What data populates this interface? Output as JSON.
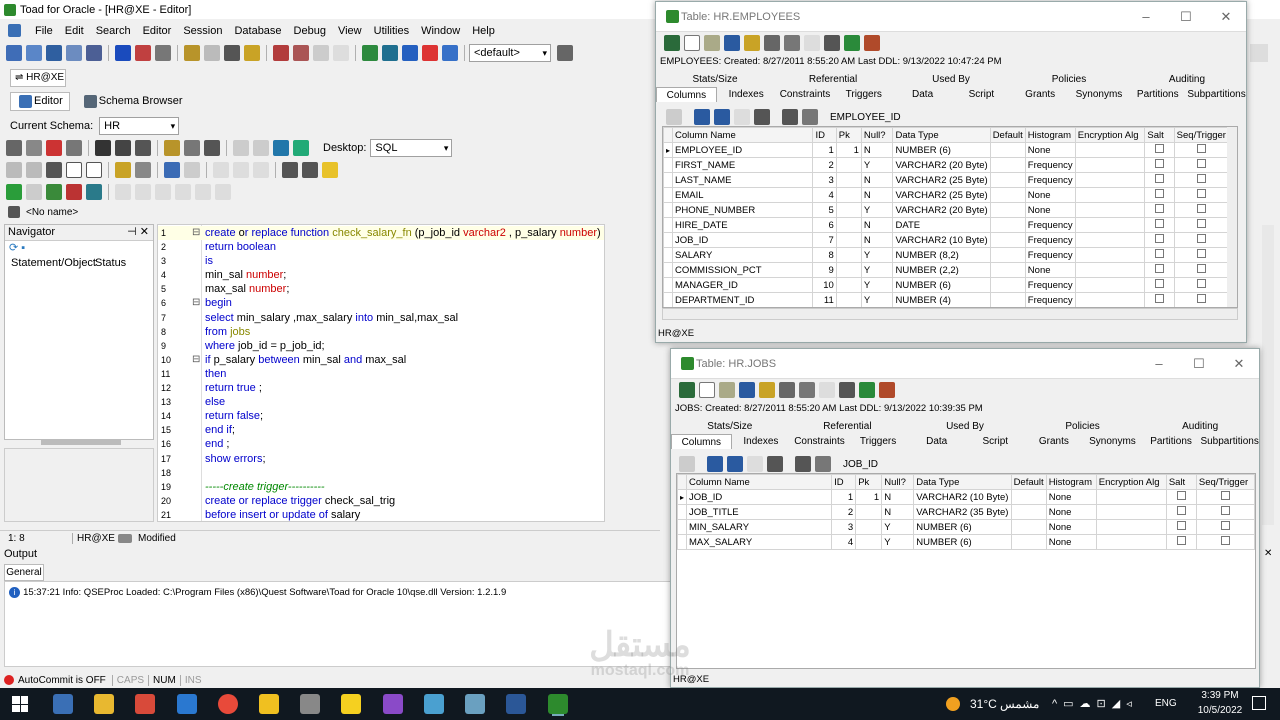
{
  "app": {
    "title": "Toad for Oracle - [HR@XE - Editor]"
  },
  "menu": [
    "File",
    "Edit",
    "Search",
    "Editor",
    "Session",
    "Database",
    "Debug",
    "View",
    "Utilities",
    "Window",
    "Help"
  ],
  "toolbar": {
    "connection_combo": "<default>"
  },
  "conn_tab": "HR@XE",
  "doc_tabs": {
    "editor": "Editor",
    "schema": "Schema Browser"
  },
  "schema": {
    "label": "Current Schema:",
    "value": "HR"
  },
  "desktop": {
    "label": "Desktop:",
    "value": "SQL"
  },
  "editor_tab": "<No name>",
  "navigator": {
    "title": "Navigator",
    "col1": "Statement/Object",
    "col2": "Status"
  },
  "code_lines": [
    {
      "n": "1",
      "html": "<span class='k'>create </span><span class='b'>o</span><span class='k'>r replace function </span> <span class='f'>check_salary_fn</span><span class='b'> (p_job_id </span><span class='t'>varchar2</span><span class='b'> , p_salary </span><span class='t'>number</span><span class='b'>)</span>"
    },
    {
      "n": "2",
      "html": "<span class='k'>return boolean</span>"
    },
    {
      "n": "3",
      "html": "<span class='k'>is</span>"
    },
    {
      "n": "4",
      "html": "<span class='b'>min_sal </span><span class='t'>number</span><span class='b'>;</span>"
    },
    {
      "n": "5",
      "html": "<span class='b'>max_sal </span><span class='t'>number</span><span class='b'>;</span>"
    },
    {
      "n": "6",
      "html": "<span class='k'>begin</span>"
    },
    {
      "n": "7",
      "html": "<span class='k'>select </span><span class='b'>min_salary ,max_salary </span><span class='k'>into </span><span class='b'>min_sal,max_sal</span>"
    },
    {
      "n": "8",
      "html": "<span class='k'>from </span><span class='f'>jobs</span>"
    },
    {
      "n": "9",
      "html": "<span class='k'>where </span><span class='b'>job_id = p_job_id;</span>"
    },
    {
      "n": "10",
      "html": "<span class='k'>if </span><span class='b'>p_salary  </span><span class='k'> between </span><span class='b'>min_sal </span><span class='k'>and </span><span class='b'>max_sal</span>"
    },
    {
      "n": "11",
      "html": "<span class='k'>then</span>"
    },
    {
      "n": "12",
      "html": "<span class='k'>return true </span><span class='b'>;</span>"
    },
    {
      "n": "13",
      "html": "<span class='k'>else</span>"
    },
    {
      "n": "14",
      "html": "<span class='k'>return false</span><span class='b'>;</span>"
    },
    {
      "n": "15",
      "html": "<span class='k'>end if</span><span class='b'>;</span>"
    },
    {
      "n": "16",
      "html": "<span class='k'>end </span><span class='b'>;</span>"
    },
    {
      "n": "17",
      "html": "<span class='k'>show errors</span><span class='b'>;</span>"
    },
    {
      "n": "18",
      "html": ""
    },
    {
      "n": "19",
      "html": "<span class='c'>-----create trigger----------</span>"
    },
    {
      "n": "20",
      "html": "<span class='k'>create or replace trigger </span><span class='b'>check_sal_trig</span>"
    },
    {
      "n": "21",
      "html": "<span class='k'>before insert or update of </span><span class='b'>salary</span>"
    }
  ],
  "status": {
    "pos": "1:  8",
    "conn": "HR@XE",
    "state": "Modified"
  },
  "output": {
    "title": "Output",
    "tab": "General",
    "message": "15:37:21 Info: QSEProc Loaded: C:\\Program Files (x86)\\Quest Software\\Toad for Oracle 10\\qse.dll  Version: 1.2.1.9"
  },
  "bottom_status": {
    "autocommit": "AutoCommit is OFF",
    "caps": "CAPS",
    "num": "NUM",
    "ins": "INS"
  },
  "tabs_row1": [
    "Stats/Size",
    "Referential",
    "Used By",
    "Policies",
    "Auditing"
  ],
  "tabs_row2": [
    "Columns",
    "Indexes",
    "Constraints",
    "Triggers",
    "Data",
    "Script",
    "Grants",
    "Synonyms",
    "Partitions",
    "Subpartitions"
  ],
  "grid_headers": [
    "Column Name",
    "ID",
    "Pk",
    "Null?",
    "Data Type",
    "Default",
    "Histogram",
    "Encryption Alg",
    "Salt",
    "Seq/Trigger"
  ],
  "emp": {
    "title": "Table:  HR.EMPLOYEES",
    "info": "EMPLOYEES:  Created: 8/27/2011 8:55:20 AM   Last DDL: 9/13/2022 10:47:24 PM",
    "combo": "EMPLOYEE_ID",
    "footer": "HR@XE",
    "rows": [
      [
        "EMPLOYEE_ID",
        "1",
        "1",
        "N",
        "NUMBER (6)",
        "",
        "None"
      ],
      [
        "FIRST_NAME",
        "2",
        "",
        "Y",
        "VARCHAR2 (20 Byte)",
        "",
        "Frequency"
      ],
      [
        "LAST_NAME",
        "3",
        "",
        "N",
        "VARCHAR2 (25 Byte)",
        "",
        "Frequency"
      ],
      [
        "EMAIL",
        "4",
        "",
        "N",
        "VARCHAR2 (25 Byte)",
        "",
        "None"
      ],
      [
        "PHONE_NUMBER",
        "5",
        "",
        "Y",
        "VARCHAR2 (20 Byte)",
        "",
        "None"
      ],
      [
        "HIRE_DATE",
        "6",
        "",
        "N",
        "DATE",
        "",
        "Frequency"
      ],
      [
        "JOB_ID",
        "7",
        "",
        "N",
        "VARCHAR2 (10 Byte)",
        "",
        "Frequency"
      ],
      [
        "SALARY",
        "8",
        "",
        "Y",
        "NUMBER (8,2)",
        "",
        "Frequency"
      ],
      [
        "COMMISSION_PCT",
        "9",
        "",
        "Y",
        "NUMBER (2,2)",
        "",
        "None"
      ],
      [
        "MANAGER_ID",
        "10",
        "",
        "Y",
        "NUMBER (6)",
        "",
        "Frequency"
      ],
      [
        "DEPARTMENT_ID",
        "11",
        "",
        "Y",
        "NUMBER (4)",
        "",
        "Frequency"
      ]
    ]
  },
  "jobs": {
    "title": "Table:  HR.JOBS",
    "info": "JOBS:   Created: 8/27/2011 8:55:20 AM    Last DDL: 9/13/2022 10:39:35 PM",
    "combo": "JOB_ID",
    "footer": "HR@XE",
    "rows": [
      [
        "JOB_ID",
        "1",
        "1",
        "N",
        "VARCHAR2 (10 Byte)",
        "",
        "None"
      ],
      [
        "JOB_TITLE",
        "2",
        "",
        "N",
        "VARCHAR2 (35 Byte)",
        "",
        "None"
      ],
      [
        "MIN_SALARY",
        "3",
        "",
        "Y",
        "NUMBER (6)",
        "",
        "None"
      ],
      [
        "MAX_SALARY",
        "4",
        "",
        "Y",
        "NUMBER (6)",
        "",
        "None"
      ]
    ]
  },
  "watermark": "مستقل",
  "watermark_url": "mostaql.com",
  "taskbar": {
    "weather": "31°C",
    "weather_desc": "مشمس",
    "lang": "ENG",
    "time": "3:39 PM",
    "date": "10/5/2022"
  }
}
